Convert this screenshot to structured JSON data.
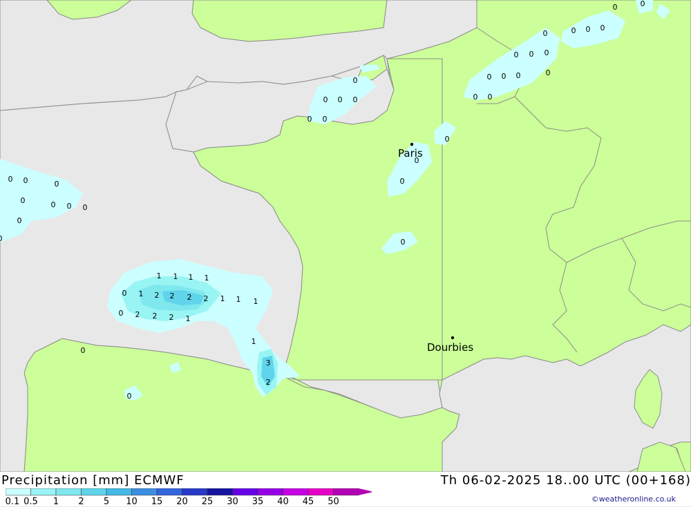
{
  "map": {
    "cities": [
      {
        "name": "Paris"
      },
      {
        "name": "Dourbies"
      }
    ],
    "value_labels": [
      "0",
      "0",
      "0",
      "0",
      "0",
      "0",
      "0",
      "0",
      "0",
      "0",
      "0",
      "0",
      "0",
      "0",
      "0",
      "0",
      "0",
      "0",
      "0",
      "0",
      "0",
      "0",
      "0",
      "0",
      "0",
      "0",
      "0",
      "0",
      "0",
      "0",
      "0",
      "0",
      "0",
      "0",
      "0",
      "0",
      "1",
      "1",
      "1",
      "1",
      "1",
      "1",
      "1",
      "1",
      "2",
      "2",
      "2",
      "2",
      "2",
      "2",
      "2",
      "3",
      "1",
      "1",
      "2",
      "0",
      "0"
    ]
  },
  "footer": {
    "title_left": "Precipitation [mm] ECMWF",
    "title_right": "Th 06-02-2025 18..00 UTC (00+168)",
    "credit": "©weatheronline.co.uk",
    "scale": [
      {
        "label": "0.1",
        "color": "#ccffff"
      },
      {
        "label": "0.5",
        "color": "#99f4f4"
      },
      {
        "label": "1",
        "color": "#7fe8ee"
      },
      {
        "label": "2",
        "color": "#5fd4ea"
      },
      {
        "label": "5",
        "color": "#45b8e6"
      },
      {
        "label": "10",
        "color": "#3c8ee0"
      },
      {
        "label": "15",
        "color": "#3264dc"
      },
      {
        "label": "20",
        "color": "#2838c8"
      },
      {
        "label": "25",
        "color": "#1414a0"
      },
      {
        "label": "30",
        "color": "#6400e6"
      },
      {
        "label": "35",
        "color": "#9600e6"
      },
      {
        "label": "40",
        "color": "#c800e6"
      },
      {
        "label": "45",
        "color": "#e600c8"
      },
      {
        "label": "50",
        "color": "#b400b4"
      }
    ]
  },
  "colors": {
    "sea": "#e8e8e8",
    "land": "#ccff99",
    "border": "#8c8c8c"
  }
}
